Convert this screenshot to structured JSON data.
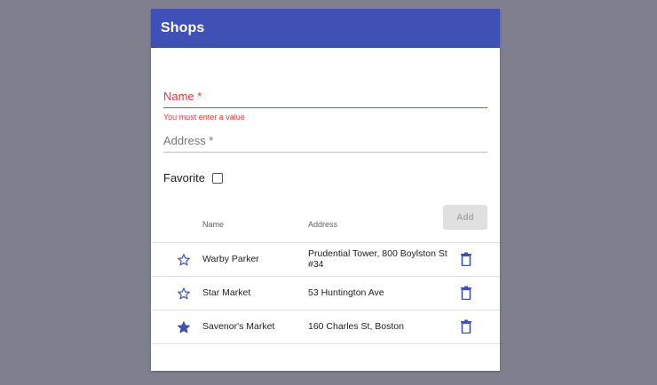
{
  "app": {
    "title": "Shops"
  },
  "form": {
    "name_label": "Name *",
    "name_error": "You must enter a value",
    "address_label": "Address *",
    "favorite_label": "Favorite",
    "favorite_checked": false,
    "add_label": "Add"
  },
  "table": {
    "headers": {
      "name": "Name",
      "address": "Address"
    },
    "rows": [
      {
        "favorite": false,
        "name": "Warby Parker",
        "address": "Prudential Tower, 800 Boylston St #34"
      },
      {
        "favorite": false,
        "name": "Star Market",
        "address": "53 Huntington Ave"
      },
      {
        "favorite": true,
        "name": "Savenor's Market",
        "address": "160 Charles St, Boston"
      }
    ]
  },
  "icons": {
    "star_outline": "star-outline-icon",
    "star_filled": "star-filled-icon",
    "delete": "trash-icon"
  },
  "colors": {
    "primary": "#3f51b5",
    "error": "#e53935",
    "background": "#7f7f8e"
  }
}
